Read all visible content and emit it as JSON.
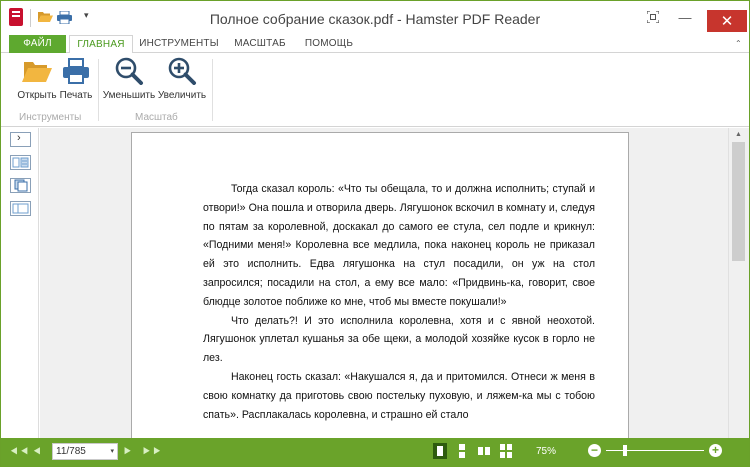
{
  "window": {
    "title": "Полное собрание сказок.pdf - Hamster PDF Reader"
  },
  "quick_access": {
    "icons": [
      "app-icon",
      "open-folder-icon",
      "print-icon",
      "customize-arrow-icon"
    ],
    "more": "▾"
  },
  "window_controls": {
    "fullscreen": "⛶",
    "minimize": "—",
    "maximize": "☐",
    "close": "✕"
  },
  "ribbon_tabs": [
    {
      "label": "ФАЙЛ"
    },
    {
      "label": "ГЛАВНАЯ"
    },
    {
      "label": "ИНСТРУМЕНТЫ"
    },
    {
      "label": "МАСШТАБ"
    },
    {
      "label": "ПОМОЩЬ"
    }
  ],
  "ribbon": {
    "collapse": "⌃",
    "buttons": {
      "open": "Открыть",
      "print": "Печать",
      "zoom_out": "Уменьшить",
      "zoom_in": "Увеличить"
    },
    "groups": {
      "tools": "Инструменты",
      "scale": "Масштаб"
    }
  },
  "side_panel": {
    "expand": "›"
  },
  "document": {
    "paragraphs": [
      "Тогда сказал король: «Что ты обещала, то и должна исполнить; ступай и отвори!» Она пошла и отворила дверь. Лягушонок вскочил в комнату и, следуя по пятам за королевной, доскакал до самого ее стула, сел подле и крикнул: «Подними меня!» Королевна все медлила, пока наконец король не приказал ей это исполнить. Едва лягушонка на стул посадили, он уж на стол запросился; посадили на стол, а ему все мало: «Придвинь-ка, говорит, свое блюдце золотое поближе ко мне, чтоб мы вместе покушали!»",
      "Что делать?! И это исполнила королевна, хотя и с явной неохотой. Лягушонок уплетал кушанья за обе щеки, а молодой хозяйке кусок в горло не лез.",
      "Наконец гость сказал: «Накушался я, да и притомился. Отнеси ж меня в свою комнатку да приготовь свою постельку пуховую, и ляжем-ка мы с тобою спать». Расплакалась королевна, и страшно ей стало"
    ]
  },
  "status_bar": {
    "first": "⯇⯇",
    "prev": "⯇",
    "page": "11/785",
    "dropdown": "▾",
    "next": "⯈",
    "last": "⯈⯈",
    "zoom": "75%",
    "zoom_minus": "−",
    "zoom_plus": "+",
    "zoom_level": 0.2
  },
  "colors": {
    "accent": "#6aa32a",
    "file_tab": "#5ea92f",
    "close": "#c7352d"
  }
}
